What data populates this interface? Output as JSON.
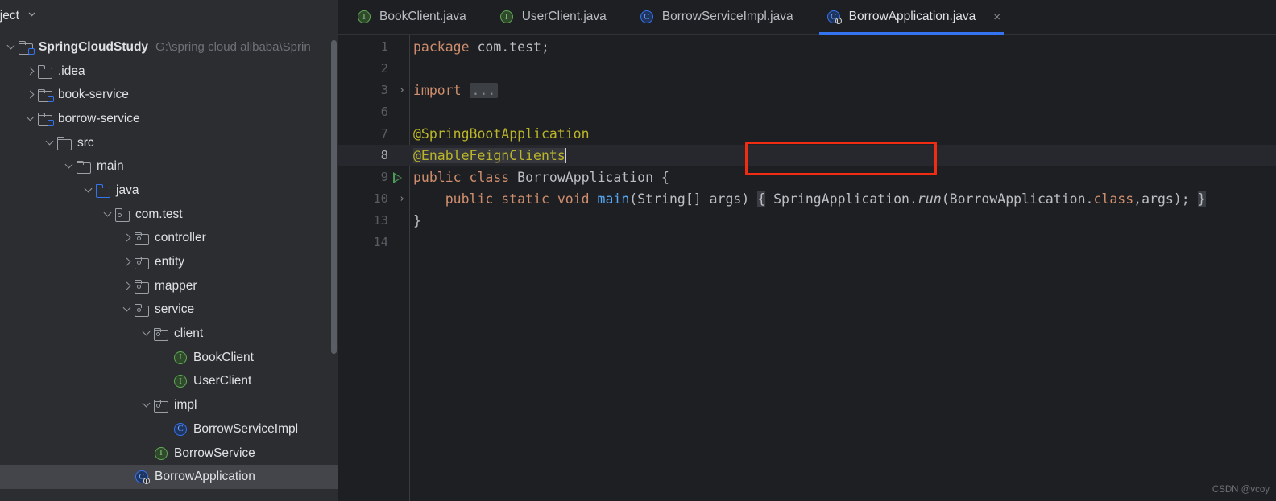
{
  "window": {
    "theme_bg": "#1e1f22",
    "accent": "#3574f0",
    "annotation_color": "#f02d13"
  },
  "sidebar": {
    "header": {
      "label": "roject",
      "chevron_icon": "chevron-down-icon"
    },
    "tree": [
      {
        "label": "SpringCloudStudy",
        "path": "G:\\spring cloud alibaba\\Sprin",
        "indent": 0,
        "twisty": "down",
        "icon": "module-folder-icon",
        "bold": true,
        "selected": false
      },
      {
        "label": ".idea",
        "path": "",
        "indent": 1,
        "twisty": "right",
        "icon": "folder-icon",
        "bold": false,
        "selected": false
      },
      {
        "label": "book-service",
        "path": "",
        "indent": 1,
        "twisty": "right",
        "icon": "module-folder-icon",
        "bold": false,
        "selected": false
      },
      {
        "label": "borrow-service",
        "path": "",
        "indent": 1,
        "twisty": "down",
        "icon": "module-folder-icon",
        "bold": false,
        "selected": false
      },
      {
        "label": "src",
        "path": "",
        "indent": 2,
        "twisty": "down",
        "icon": "folder-icon",
        "bold": false,
        "selected": false
      },
      {
        "label": "main",
        "path": "",
        "indent": 3,
        "twisty": "down",
        "icon": "folder-icon",
        "bold": false,
        "selected": false
      },
      {
        "label": "java",
        "path": "",
        "indent": 4,
        "twisty": "down",
        "icon": "source-root-folder-icon",
        "bold": false,
        "selected": false
      },
      {
        "label": "com.test",
        "path": "",
        "indent": 5,
        "twisty": "down",
        "icon": "package-icon",
        "bold": false,
        "selected": false
      },
      {
        "label": "controller",
        "path": "",
        "indent": 6,
        "twisty": "right",
        "icon": "package-icon",
        "bold": false,
        "selected": false
      },
      {
        "label": "entity",
        "path": "",
        "indent": 6,
        "twisty": "right",
        "icon": "package-icon",
        "bold": false,
        "selected": false
      },
      {
        "label": "mapper",
        "path": "",
        "indent": 6,
        "twisty": "right",
        "icon": "package-icon",
        "bold": false,
        "selected": false
      },
      {
        "label": "service",
        "path": "",
        "indent": 6,
        "twisty": "down",
        "icon": "package-icon",
        "bold": false,
        "selected": false
      },
      {
        "label": "client",
        "path": "",
        "indent": 7,
        "twisty": "down",
        "icon": "package-icon",
        "bold": false,
        "selected": false
      },
      {
        "label": "BookClient",
        "path": "",
        "indent": 8,
        "twisty": "none",
        "icon": "interface-icon",
        "bold": false,
        "selected": false
      },
      {
        "label": "UserClient",
        "path": "",
        "indent": 8,
        "twisty": "none",
        "icon": "interface-icon",
        "bold": false,
        "selected": false
      },
      {
        "label": "impl",
        "path": "",
        "indent": 7,
        "twisty": "down",
        "icon": "package-icon",
        "bold": false,
        "selected": false
      },
      {
        "label": "BorrowServiceImpl",
        "path": "",
        "indent": 8,
        "twisty": "none",
        "icon": "class-icon",
        "bold": false,
        "selected": false
      },
      {
        "label": "BorrowService",
        "path": "",
        "indent": 7,
        "twisty": "none",
        "icon": "interface-icon",
        "bold": false,
        "selected": false
      },
      {
        "label": "BorrowApplication",
        "path": "",
        "indent": 6,
        "twisty": "none",
        "icon": "spring-class-icon",
        "bold": false,
        "selected": true
      }
    ],
    "scrollbar": {
      "name": "sidebar-scrollbar"
    }
  },
  "tabs": [
    {
      "label": "BookClient.java",
      "icon": "interface-icon",
      "active": false,
      "closable": false
    },
    {
      "label": "UserClient.java",
      "icon": "interface-icon",
      "active": false,
      "closable": false
    },
    {
      "label": "BorrowServiceImpl.java",
      "icon": "class-icon",
      "active": false,
      "closable": false
    },
    {
      "label": "BorrowApplication.java",
      "icon": "spring-class-icon",
      "active": true,
      "closable": true,
      "close_label": "×"
    }
  ],
  "editor": {
    "file": "BorrowApplication.java",
    "language": "java",
    "caret_line": 8,
    "lines": [
      {
        "num": "1",
        "fold": "",
        "run": false,
        "current": false
      },
      {
        "num": "2",
        "fold": "",
        "run": false,
        "current": false
      },
      {
        "num": "3",
        "fold": "›",
        "run": false,
        "current": false
      },
      {
        "num": "6",
        "fold": "",
        "run": false,
        "current": false
      },
      {
        "num": "7",
        "fold": "",
        "run": false,
        "current": false
      },
      {
        "num": "8",
        "fold": "",
        "run": false,
        "current": true
      },
      {
        "num": "9",
        "fold": "",
        "run": true,
        "current": false
      },
      {
        "num": "10",
        "fold": "›",
        "run": false,
        "current": false
      },
      {
        "num": "13",
        "fold": "",
        "run": false,
        "current": false
      },
      {
        "num": "14",
        "fold": "",
        "run": false,
        "current": false
      }
    ],
    "code": {
      "l1_kw": "package",
      "l1_rest": " com.test;",
      "l3_kw": "import",
      "l3_fold": "...",
      "l7_anno": "@SpringBootApplication",
      "l8_anno": "@EnableFeignClients",
      "l9_kw1": "public",
      "l9_kw2": "class",
      "l9_name": "BorrowApplication",
      "l9_brace": "{",
      "l10_kw1": "public",
      "l10_kw2": "static",
      "l10_kw3": "void",
      "l10_fn": "main",
      "l10_params": "(String[] args)",
      "l10_open": "{",
      "l10_body": " SpringApplication.",
      "l10_run": "run",
      "l10_args_open": "(BorrowApplication.",
      "l10_class_kw": "class",
      "l10_args_rest": ",args);",
      "l10_close": "}",
      "l13_brace": "}"
    }
  },
  "annotation": {
    "name": "red-highlight-box",
    "target": "@EnableFeignClients"
  },
  "watermark": {
    "text": "CSDN @vcoy"
  }
}
